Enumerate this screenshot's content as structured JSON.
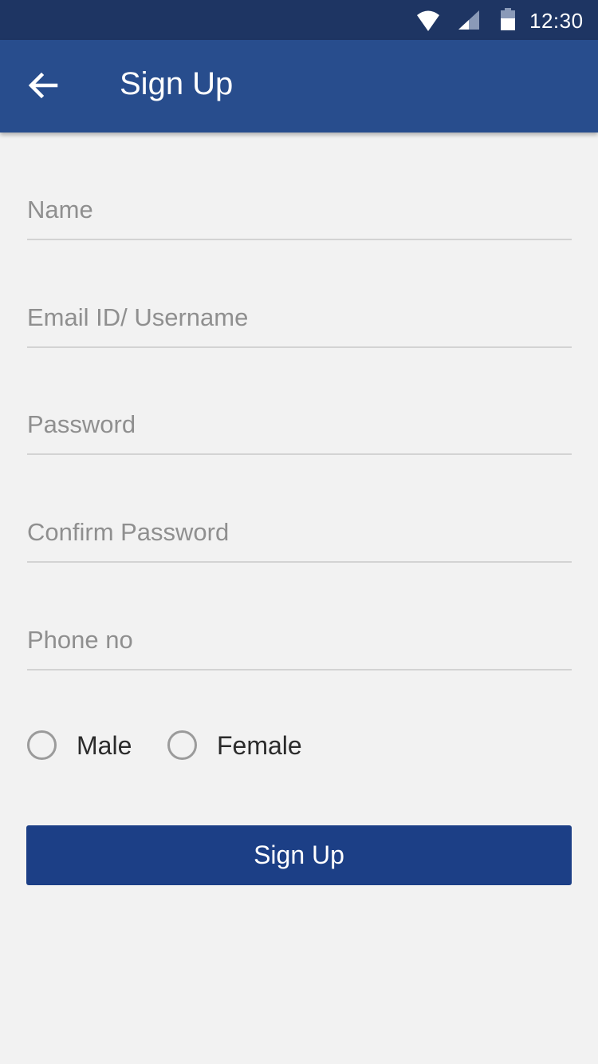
{
  "status_bar": {
    "time": "12:30",
    "icons": [
      "wifi-icon",
      "cell-signal-icon",
      "battery-icon"
    ]
  },
  "app_bar": {
    "title": "Sign Up",
    "back_icon": "arrow-left-icon"
  },
  "form": {
    "name": {
      "placeholder": "Name",
      "value": ""
    },
    "email": {
      "placeholder": "Email ID/ Username",
      "value": ""
    },
    "password": {
      "placeholder": "Password",
      "value": ""
    },
    "confirm_password": {
      "placeholder": "Confirm Password",
      "value": ""
    },
    "phone": {
      "placeholder": "Phone no",
      "value": ""
    },
    "gender": {
      "options": [
        "Male",
        "Female"
      ],
      "selected": null
    },
    "submit_label": "Sign Up"
  },
  "colors": {
    "status_bar": "#1e3563",
    "app_bar": "#284d8d",
    "background": "#f2f2f2",
    "button": "#1c3f86",
    "placeholder": "#8f8f8f",
    "underline": "#d3d3d3",
    "radio_border": "#9b9b9b"
  }
}
